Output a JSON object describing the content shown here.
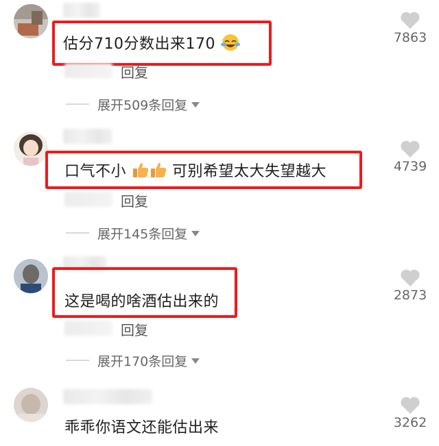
{
  "comments": [
    {
      "text": "估分710分数出来170",
      "emoji": "rolling-laughing-emoji",
      "reply_label": "回复",
      "expand_label": "展开509条回复",
      "likes": "7863",
      "highlighted": true
    },
    {
      "text_before": "口气不小",
      "text_after": "可别希望太大失望越大",
      "emoji": "thumbs-up-emoji",
      "reply_label": "回复",
      "expand_label": "展开145条回复",
      "likes": "4739",
      "highlighted": true
    },
    {
      "text": "这是喝的啥酒估出来的",
      "reply_label": "回复",
      "expand_label": "展开170条回复",
      "likes": "2873",
      "highlighted": true
    },
    {
      "text": "乖乖你语文还能估出来",
      "likes": "3262",
      "highlighted": false
    }
  ],
  "colors": {
    "highlight_border": "#ef1a1a",
    "like_icon": "#cfcfcf"
  }
}
